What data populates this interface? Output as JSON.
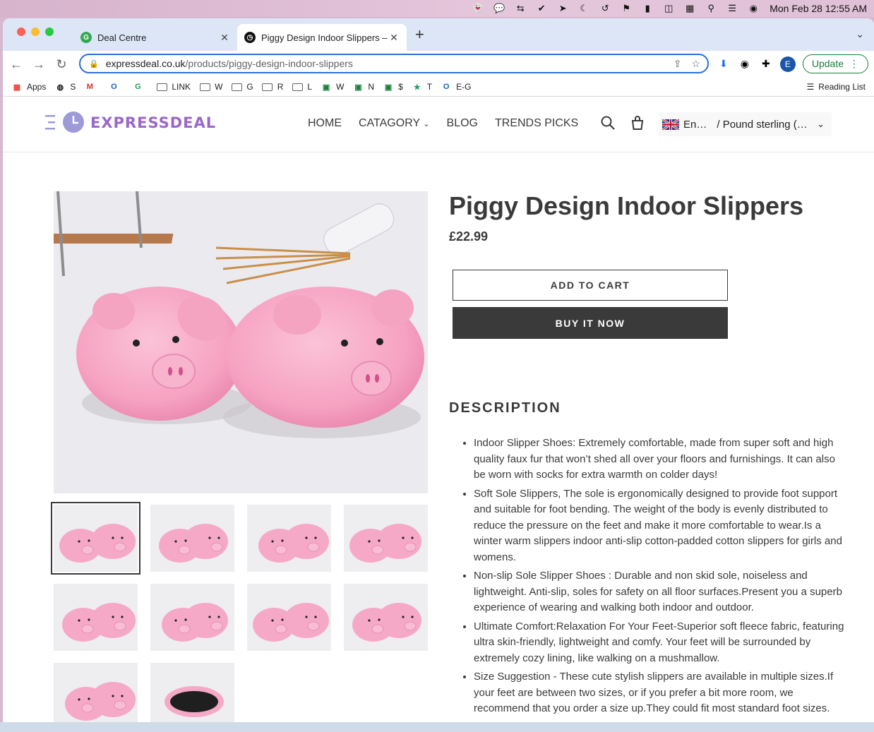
{
  "menubar": {
    "clock": "Mon Feb 28  12:55 AM"
  },
  "browser": {
    "tabs": [
      {
        "title": "Deal Centre",
        "active": false
      },
      {
        "title": "Piggy Design Indoor Slippers – Expressdeal",
        "active": true
      }
    ],
    "url_host": "expressdeal.co.uk",
    "url_path": "/products/piggy-design-indoor-slippers",
    "update_label": "Update",
    "profile_initial": "E",
    "bookmarks": [
      {
        "label": "Apps",
        "icon": "apps-grid-icon"
      },
      {
        "label": "S",
        "icon": "globe-icon"
      },
      {
        "label": "",
        "icon": "gmail-icon"
      },
      {
        "label": "",
        "icon": "outlook-icon"
      },
      {
        "label": "",
        "icon": "grammarly-icon"
      },
      {
        "label": "LINK",
        "icon": "folder-icon"
      },
      {
        "label": "W",
        "icon": "folder-icon"
      },
      {
        "label": "G",
        "icon": "folder-icon"
      },
      {
        "label": "R",
        "icon": "folder-icon"
      },
      {
        "label": "L",
        "icon": "folder-icon"
      },
      {
        "label": "W",
        "icon": "sheets-icon"
      },
      {
        "label": "N",
        "icon": "sheets-icon"
      },
      {
        "label": "$",
        "icon": "sheets-icon"
      },
      {
        "label": "T",
        "icon": "star-icon"
      },
      {
        "label": "E-G",
        "icon": "outlook-icon"
      }
    ],
    "reading_list": "Reading List"
  },
  "site": {
    "logo_text": "EXPRESSDEAL",
    "nav": [
      {
        "label": "HOME"
      },
      {
        "label": "CATAGORY",
        "has_dropdown": true
      },
      {
        "label": "BLOG"
      },
      {
        "label": "TRENDS PICKS"
      }
    ],
    "language": "En…",
    "currency": "/ Pound sterling (…"
  },
  "product": {
    "title": "Piggy Design Indoor Slippers",
    "price": "£22.99",
    "add_to_cart": "ADD TO CART",
    "buy_now": "BUY IT NOW",
    "description_heading": "DESCRIPTION",
    "description": [
      "Indoor Slipper Shoes: Extremely comfortable, made from super soft and high quality faux fur that won’t shed all over your floors and furnishings. It can also  be worn with socks for extra warmth on colder days!",
      "Soft Sole Slippers, The sole is ergonomically designed to provide foot support and suitable for foot bending. The weight of the body is evenly distributed to reduce the pressure on the feet and make it more comfortable to wear.Is a winter warm slippers indoor anti-slip cotton-padded cotton slippers for girls and womens.",
      "Non-slip Sole Slipper Shoes : Durable and non skid sole, noiseless and lightweight. Anti-slip, soles for safety on all floor surfaces.Present you a superb experience of wearing and walking both indoor and outdoor.",
      "Ultimate Comfort:Relaxation For Your Feet-Superior soft fleece fabric, featuring ultra skin-friendly, lightweight and comfy. Your feet will be surrounded by extremely cozy lining, like walking on a mushmallow.",
      "Size Suggestion - These cute stylish slippers are available in multiple sizes.If your feet are between two sizes, or if you prefer a bit more room, we recommend that you order a size up.They could fit most standard foot sizes."
    ],
    "thumbnail_count": 10,
    "selected_thumbnail": 1
  },
  "colors": {
    "accent_purple": "#9b67c9",
    "text_dark": "#3a3a3a",
    "buy_button": "#3a3a3a",
    "pig_pink": "#f6a9c6"
  }
}
